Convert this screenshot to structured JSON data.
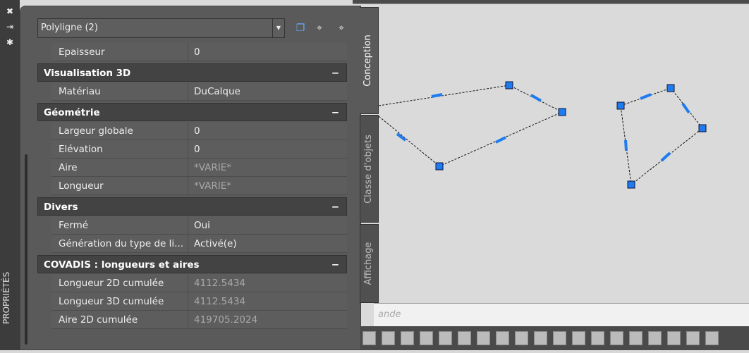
{
  "palette": {
    "panel": "#5a5a5a",
    "header": "#434343",
    "grip": "#1e7bf0"
  },
  "left_strip": {
    "close": "✖",
    "autohide": "⇥",
    "settings": "✱",
    "label": "PROPRIÉTÉS"
  },
  "selector": {
    "value": "Polyligne (2)"
  },
  "toolbar_icons": [
    "add-selection-icon",
    "pick-objects-icon",
    "quick-select-icon"
  ],
  "rows": {
    "epaisseur": {
      "k": "Epaisseur",
      "v": "0"
    },
    "sec_vis": "Visualisation 3D",
    "materiau": {
      "k": "Matériau",
      "v": "DuCalque"
    },
    "sec_geo": "Géométrie",
    "largeur": {
      "k": "Largeur globale",
      "v": "0"
    },
    "elevation": {
      "k": "Elévation",
      "v": "0"
    },
    "aire": {
      "k": "Aire",
      "v": "*VARIE*"
    },
    "longueur": {
      "k": "Longueur",
      "v": "*VARIE*"
    },
    "sec_divers": "Divers",
    "ferme": {
      "k": "Fermé",
      "v": "Oui"
    },
    "generation": {
      "k": "Génération du type de li...",
      "v": "Activé(e)"
    },
    "sec_covadis": "COVADIS : longueurs et aires",
    "l2d": {
      "k": "Longueur 2D cumulée",
      "v": "4112.5434"
    },
    "l3d": {
      "k": "Longueur 3D cumulée",
      "v": "4112.5434"
    },
    "a2d": {
      "k": "Aire 2D cumulée",
      "v": "419705.2024"
    }
  },
  "collapse": "−",
  "tabs": [
    "Conception",
    "Classe d'objets",
    "Affichage"
  ],
  "command": {
    "placeholder": "ande"
  }
}
